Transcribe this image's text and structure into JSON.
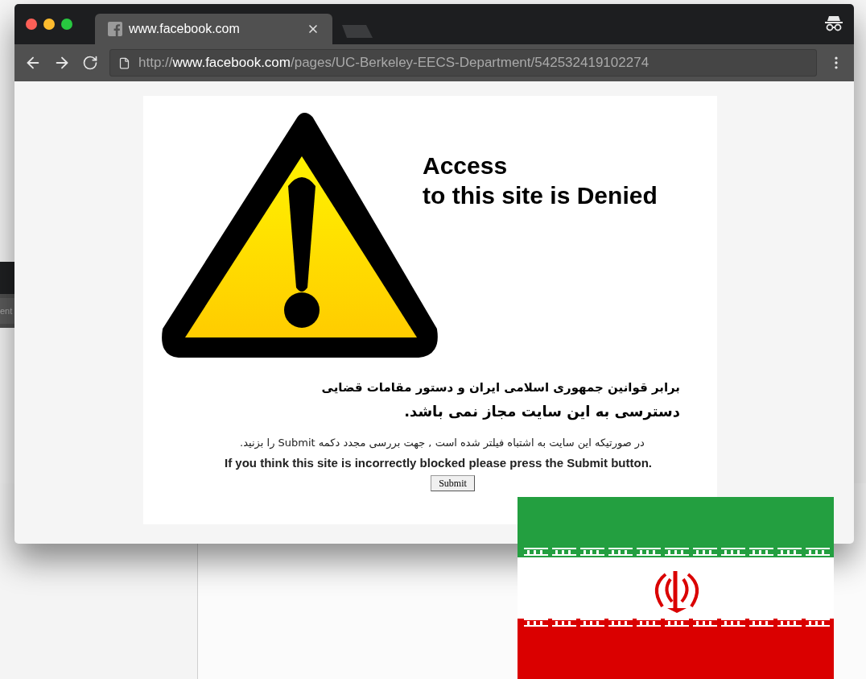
{
  "background_window": {
    "field_text": "ent"
  },
  "browser": {
    "tabs": [
      {
        "title": "www.facebook.com",
        "selected": true
      }
    ],
    "address_bar": {
      "parts": [
        {
          "text": "http://",
          "emphasis": false
        },
        {
          "text": "www.facebook.com",
          "emphasis": true
        },
        {
          "text": "/pages/UC-Berkeley-EECS-Department/542532419102274",
          "emphasis": false
        }
      ]
    }
  },
  "page": {
    "heading": "Access\nto this site is Denied",
    "notice_lines": [
      "برابر قوانين جمهوری اسلامی ايران و دستور مقامات قضايی",
      "دسترسی به اين سايت مجاز نمی باشد."
    ],
    "help_persian": "در صورتيكه اين سايت به اشتباه فيلتر شده است , جهت بررسی مجدد دكمه Submit را بزنيد.",
    "help_english": "If you think this site is incorrectly blocked please press the Submit button.",
    "submit_button": "Submit"
  }
}
